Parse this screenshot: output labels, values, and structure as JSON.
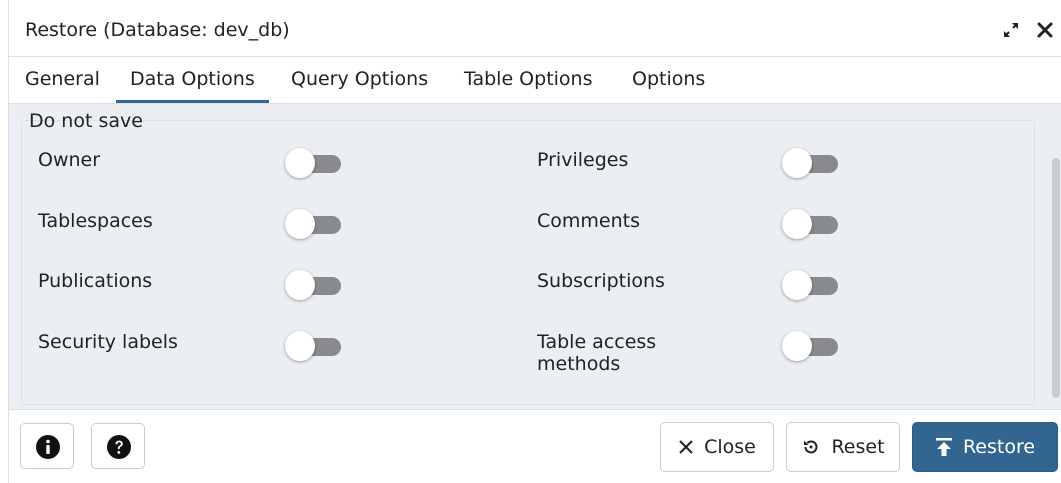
{
  "dialog": {
    "title": "Restore (Database: dev_db)"
  },
  "tabs": [
    {
      "label": "General",
      "active": false
    },
    {
      "label": "Data Options",
      "active": true
    },
    {
      "label": "Query Options",
      "active": false
    },
    {
      "label": "Table Options",
      "active": false
    },
    {
      "label": "Options",
      "active": false
    }
  ],
  "section": {
    "legend": "Do not save",
    "options": [
      {
        "label": "Owner",
        "enabled": false
      },
      {
        "label": "Privileges",
        "enabled": false
      },
      {
        "label": "Tablespaces",
        "enabled": false
      },
      {
        "label": "Comments",
        "enabled": false
      },
      {
        "label": "Publications",
        "enabled": false
      },
      {
        "label": "Subscriptions",
        "enabled": false
      },
      {
        "label": "Security labels",
        "enabled": false
      },
      {
        "label": "Table access methods",
        "label_line1": "Table access",
        "label_line2": "methods",
        "enabled": false
      }
    ]
  },
  "footer": {
    "info_icon": "info-icon",
    "help_icon": "help-icon",
    "close_label": "Close",
    "reset_label": "Reset",
    "restore_label": "Restore"
  },
  "colors": {
    "accent": "#326690",
    "content_bg": "#ebeef3",
    "toggle_off_track": "#888a8e"
  }
}
